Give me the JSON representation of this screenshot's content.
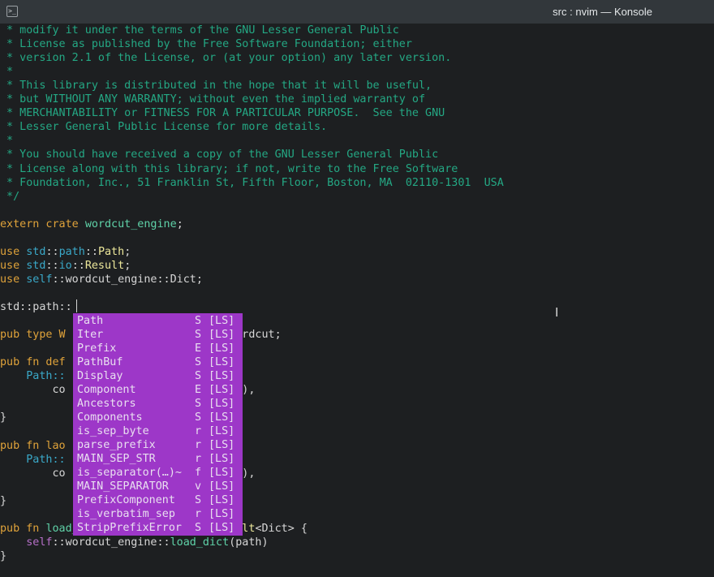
{
  "window": {
    "title": "src : nvim — Konsole",
    "icon": "terminal-icon"
  },
  "colors": {
    "background": "#1d1f21",
    "comment": "#24a884",
    "keyword": "#e0a33a",
    "module": "#3aa9c9",
    "popup_bg": "#9d37c8",
    "popup_text": "#e9dff0"
  },
  "code_lines": [
    {
      "line": 1,
      "segments": [
        {
          "t": " * modify it under the terms of the GNU Lesser General Public",
          "c": "comment"
        }
      ]
    },
    {
      "line": 2,
      "segments": [
        {
          "t": " * License as published by the Free Software Foundation; either",
          "c": "comment"
        }
      ]
    },
    {
      "line": 3,
      "segments": [
        {
          "t": " * version 2.1 of the License, or (at your option) any later version.",
          "c": "comment"
        }
      ]
    },
    {
      "line": 4,
      "segments": [
        {
          "t": " *",
          "c": "comment"
        }
      ]
    },
    {
      "line": 5,
      "segments": [
        {
          "t": " * This library is distributed in the hope that it will be useful,",
          "c": "comment"
        }
      ]
    },
    {
      "line": 6,
      "segments": [
        {
          "t": " * but WITHOUT ANY WARRANTY; without even the implied warranty of",
          "c": "comment"
        }
      ]
    },
    {
      "line": 7,
      "segments": [
        {
          "t": " * MERCHANTABILITY or FITNESS FOR A PARTICULAR PURPOSE.  See the GNU",
          "c": "comment"
        }
      ]
    },
    {
      "line": 8,
      "segments": [
        {
          "t": " * Lesser General Public License for more details.",
          "c": "comment"
        }
      ]
    },
    {
      "line": 9,
      "segments": [
        {
          "t": " *",
          "c": "comment"
        }
      ]
    },
    {
      "line": 10,
      "segments": [
        {
          "t": " * You should have received a copy of the GNU Lesser General Public",
          "c": "comment"
        }
      ]
    },
    {
      "line": 11,
      "segments": [
        {
          "t": " * License along with this library; if not, write to the Free Software",
          "c": "comment"
        }
      ]
    },
    {
      "line": 12,
      "segments": [
        {
          "t": " * Foundation, Inc., 51 Franklin St, Fifth Floor, Boston, MA  02110-1301  USA",
          "c": "comment"
        }
      ]
    },
    {
      "line": 13,
      "segments": [
        {
          "t": " */",
          "c": "comment"
        }
      ]
    },
    {
      "line": 14,
      "segments": []
    },
    {
      "line": 15,
      "segments": [
        {
          "t": "extern crate ",
          "c": "kw"
        },
        {
          "t": "wordcut_engine",
          "c": "fn"
        },
        {
          "t": ";",
          "c": "ident"
        }
      ]
    },
    {
      "line": 16,
      "segments": []
    },
    {
      "line": 17,
      "segments": [
        {
          "t": "use ",
          "c": "kw"
        },
        {
          "t": "std",
          "c": "mod"
        },
        {
          "t": "::",
          "c": "ident"
        },
        {
          "t": "path",
          "c": "mod"
        },
        {
          "t": "::",
          "c": "ident"
        },
        {
          "t": "Path",
          "c": "type"
        },
        {
          "t": ";",
          "c": "ident"
        }
      ]
    },
    {
      "line": 18,
      "segments": [
        {
          "t": "use ",
          "c": "kw"
        },
        {
          "t": "std",
          "c": "mod"
        },
        {
          "t": "::",
          "c": "ident"
        },
        {
          "t": "io",
          "c": "mod"
        },
        {
          "t": "::",
          "c": "ident"
        },
        {
          "t": "Result",
          "c": "type"
        },
        {
          "t": ";",
          "c": "ident"
        }
      ]
    },
    {
      "line": 19,
      "segments": [
        {
          "t": "use ",
          "c": "kw"
        },
        {
          "t": "self",
          "c": "mod"
        },
        {
          "t": "::",
          "c": "ident"
        },
        {
          "t": "wordcut_engine",
          "c": "ident"
        },
        {
          "t": "::",
          "c": "ident"
        },
        {
          "t": "Dict",
          "c": "ident"
        },
        {
          "t": ";",
          "c": "ident"
        }
      ]
    },
    {
      "line": 20,
      "segments": []
    },
    {
      "line": 21,
      "segments": [
        {
          "t": "std::path::",
          "c": "ident"
        }
      ]
    },
    {
      "line": 22,
      "segments": []
    },
    {
      "line": 23,
      "segments": [
        {
          "t": "pub type W",
          "c": "kw"
        },
        {
          "t": "                   ",
          "c": "ident"
        },
        {
          "t": "gine",
          "c": "mod"
        },
        {
          "t": "::",
          "c": "ident"
        },
        {
          "t": "Wordcut",
          "c": "ident"
        },
        {
          "t": ";",
          "c": "ident"
        }
      ]
    },
    {
      "line": 24,
      "segments": []
    },
    {
      "line": 25,
      "segments": [
        {
          "t": "pub fn def",
          "c": "kw"
        },
        {
          "t": "                     ath {",
          "c": "ident"
        }
      ]
    },
    {
      "line": 26,
      "segments": [
        {
          "t": "    Path::",
          "c": "mod"
        }
      ]
    },
    {
      "line": 27,
      "segments": [
        {
          "t": "        co",
          "c": "ident"
        },
        {
          "t": "                     T_DIR\"",
          "c": "str"
        },
        {
          "t": "),",
          "c": "ident"
        }
      ]
    },
    {
      "line": 28,
      "segments": []
    },
    {
      "line": 29,
      "segments": [
        {
          "t": "}",
          "c": "ident"
        }
      ]
    },
    {
      "line": 30,
      "segments": []
    },
    {
      "line": 31,
      "segments": [
        {
          "t": "pub fn lao",
          "c": "kw"
        },
        {
          "t": "                     {",
          "c": "ident"
        }
      ]
    },
    {
      "line": 32,
      "segments": [
        {
          "t": "    Path::",
          "c": "mod"
        }
      ]
    },
    {
      "line": 33,
      "segments": [
        {
          "t": "        co",
          "c": "ident"
        },
        {
          "t": "                     T_DIR\"",
          "c": "str"
        },
        {
          "t": "),",
          "c": "ident"
        }
      ]
    },
    {
      "line": 34,
      "segments": [
        {
          "t": "                             \"))",
          "c": "ident"
        }
      ]
    },
    {
      "line": 35,
      "segments": [
        {
          "t": "}",
          "c": "ident"
        }
      ]
    },
    {
      "line": 36,
      "segments": []
    },
    {
      "line": 37,
      "segments": [
        {
          "t": "pub fn ",
          "c": "kw"
        },
        {
          "t": "load_dict",
          "c": "fn"
        },
        {
          "t": "(path: &",
          "c": "ident"
        },
        {
          "t": "Path",
          "c": "type"
        },
        {
          "t": ") -> ",
          "c": "ident"
        },
        {
          "t": "Result",
          "c": "type"
        },
        {
          "t": "<Dict> {",
          "c": "ident"
        }
      ]
    },
    {
      "line": 38,
      "segments": [
        {
          "t": "    self",
          "c": "self"
        },
        {
          "t": "::wordcut_engine::",
          "c": "ident"
        },
        {
          "t": "load_dict",
          "c": "fn"
        },
        {
          "t": "(path)",
          "c": "ident"
        }
      ]
    },
    {
      "line": 39,
      "segments": [
        {
          "t": "}",
          "c": "ident"
        }
      ]
    }
  ],
  "completion": {
    "items": [
      {
        "word": "Path",
        "kind": "S",
        "source": "[LS]"
      },
      {
        "word": "Iter",
        "kind": "S",
        "source": "[LS]"
      },
      {
        "word": "Prefix",
        "kind": "E",
        "source": "[LS]"
      },
      {
        "word": "PathBuf",
        "kind": "S",
        "source": "[LS]"
      },
      {
        "word": "Display",
        "kind": "S",
        "source": "[LS]"
      },
      {
        "word": "Component",
        "kind": "E",
        "source": "[LS]"
      },
      {
        "word": "Ancestors",
        "kind": "S",
        "source": "[LS]"
      },
      {
        "word": "Components",
        "kind": "S",
        "source": "[LS]"
      },
      {
        "word": "is_sep_byte",
        "kind": "r",
        "source": "[LS]"
      },
      {
        "word": "parse_prefix",
        "kind": "r",
        "source": "[LS]"
      },
      {
        "word": "MAIN_SEP_STR",
        "kind": "r",
        "source": "[LS]"
      },
      {
        "word": "is_separator(…)~",
        "kind": "f",
        "source": "[LS]"
      },
      {
        "word": "MAIN_SEPARATOR",
        "kind": "v",
        "source": "[LS]"
      },
      {
        "word": "PrefixComponent",
        "kind": "S",
        "source": "[LS]"
      },
      {
        "word": "is_verbatim_sep",
        "kind": "r",
        "source": "[LS]"
      },
      {
        "word": "StripPrefixError",
        "kind": "S",
        "source": "[LS]"
      }
    ]
  }
}
